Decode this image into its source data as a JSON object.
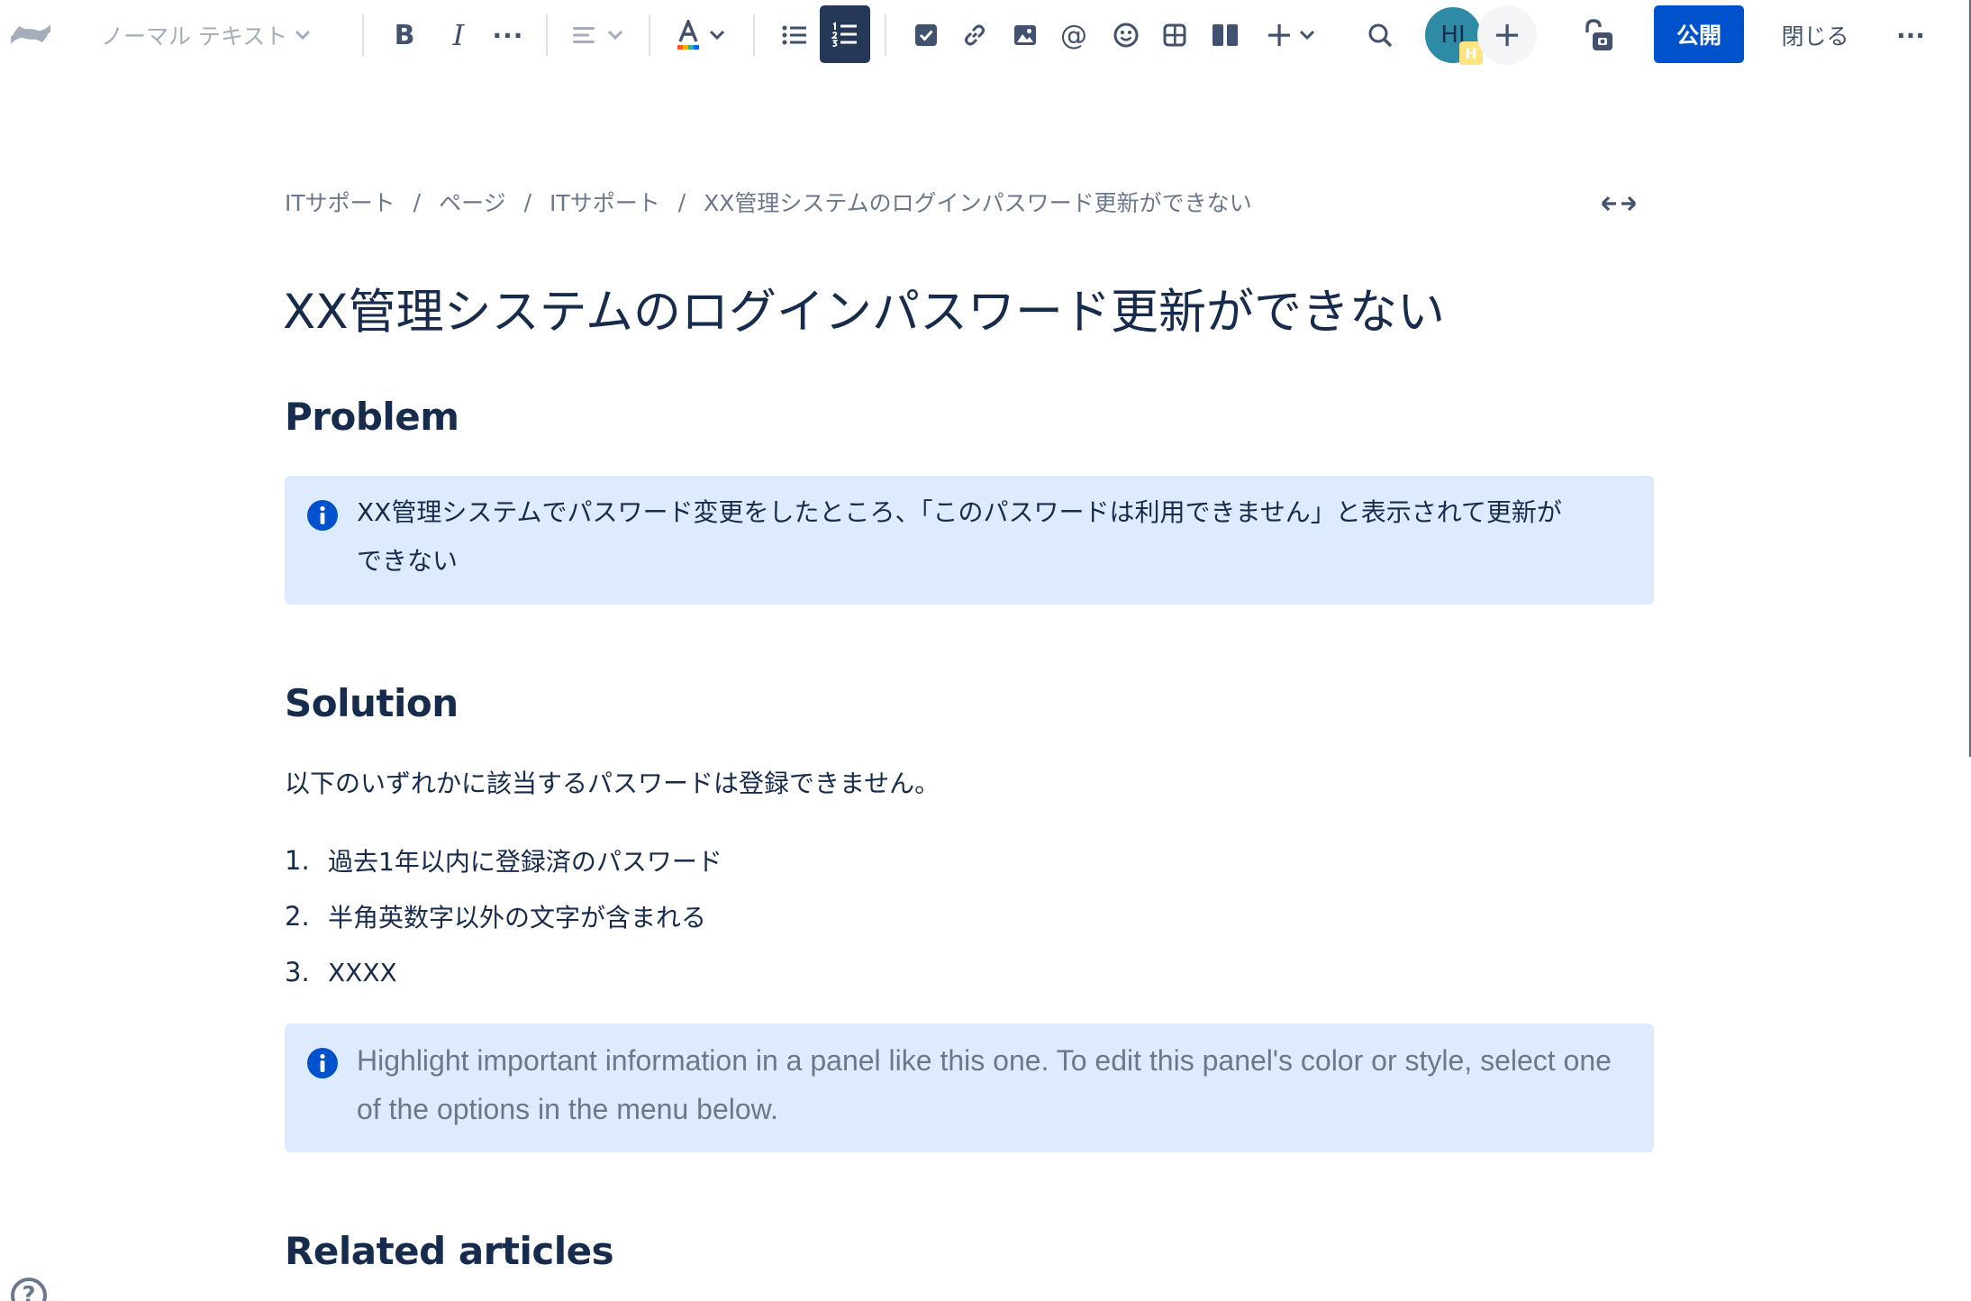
{
  "toolbar": {
    "text_style": "ノーマル テキスト",
    "bold_label": "B",
    "italic_label": "I",
    "more_format_label": "···",
    "mention_label": "@",
    "avatar_initials": "HI",
    "avatar_badge": "H",
    "publish_label": "公開",
    "close_label": "閉じる",
    "more_label": "···"
  },
  "breadcrumb": [
    "ITサポート",
    "ページ",
    "ITサポート",
    "XX管理システムのログインパスワード更新ができない"
  ],
  "page": {
    "title": "XX管理システムのログインパスワード更新ができない",
    "problem_heading": "Problem",
    "problem_panel_line1": "XX管理システムでパスワード変更をしたところ、「このパスワードは利用できません」と表示されて更新が",
    "problem_panel_line2": "できない",
    "solution_heading": "Solution",
    "solution_intro": "以下のいずれかに該当するパスワードは登録できません。",
    "solution_items": [
      {
        "num": "1.",
        "text": "過去1年以内に登録済のパスワード"
      },
      {
        "num": "2.",
        "text": "半角英数字以外の文字が含まれる"
      },
      {
        "num": "3.",
        "text": "XXXX"
      }
    ],
    "info_panel_line1": "Highlight important information in a panel like this one. To edit this panel's color or style, select one",
    "info_panel_line2": "of the options in the menu below.",
    "related_heading": "Related articles"
  },
  "help_label": "?",
  "colors": {
    "primary": "#0052cc",
    "panel_bg": "#deebff",
    "text": "#172b4d",
    "subtle": "#6b778c",
    "toolbar_active": "#253858"
  }
}
